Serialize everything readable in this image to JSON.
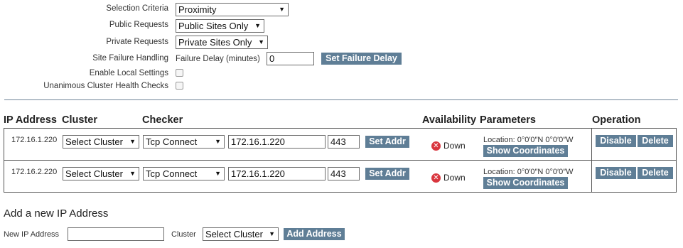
{
  "settings": {
    "selection_criteria": {
      "label": "Selection Criteria",
      "value": "Proximity"
    },
    "public_requests": {
      "label": "Public Requests",
      "value": "Public Sites Only"
    },
    "private_requests": {
      "label": "Private Requests",
      "value": "Private Sites Only"
    },
    "site_failure": {
      "label": "Site Failure Handling",
      "delay_label": "Failure Delay (minutes)",
      "delay_value": "0",
      "button": "Set Failure Delay"
    },
    "enable_local": {
      "label": "Enable Local Settings"
    },
    "unanimous": {
      "label": "Unanimous Cluster Health Checks"
    }
  },
  "table": {
    "headers": {
      "ip": "IP Address",
      "cluster": "Cluster",
      "checker": "Checker",
      "availability": "Availability",
      "parameters": "Parameters",
      "operation": "Operation"
    },
    "rows": [
      {
        "ip": "172.16.1.220",
        "cluster": "Select Cluster",
        "checker": "Tcp Connect",
        "addr": "172.16.1.220",
        "port": "443",
        "set_addr": "Set Addr",
        "status": "Down",
        "location": "Location: 0°0′0″N 0°0′0″W",
        "show_coords": "Show Coordinates",
        "disable": "Disable",
        "delete": "Delete"
      },
      {
        "ip": "172.16.2.220",
        "cluster": "Select Cluster",
        "checker": "Tcp Connect",
        "addr": "172.16.1.220",
        "port": "443",
        "set_addr": "Set Addr",
        "status": "Down",
        "location": "Location: 0°0′0″N 0°0′0″W",
        "show_coords": "Show Coordinates",
        "disable": "Disable",
        "delete": "Delete"
      }
    ]
  },
  "add_form": {
    "title": "Add a new IP Address",
    "ip_label": "New IP Address",
    "ip_value": "",
    "cluster_label": "Cluster",
    "cluster_value": "Select Cluster",
    "button": "Add Address"
  },
  "colors": {
    "button": "#5f7e96",
    "status_down": "#d9363e"
  },
  "icons": {
    "status_down": "x-circle-icon",
    "dropdown": "chevron-down-icon"
  }
}
